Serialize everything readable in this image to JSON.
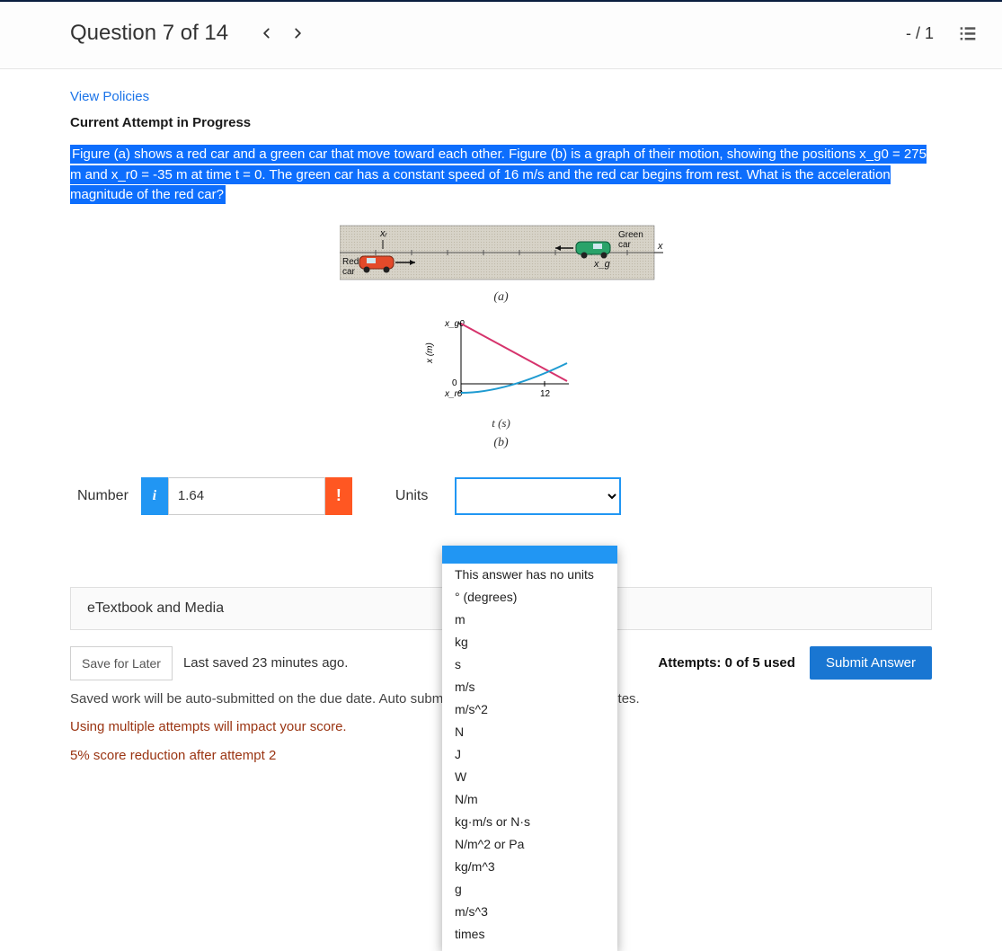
{
  "header": {
    "title": "Question 7 of 14",
    "score": "- / 1"
  },
  "policies_link": "View Policies",
  "attempt_status": "Current Attempt in Progress",
  "question": {
    "text": "Figure (a) shows a red car and a green car that move toward each other. Figure (b) is a graph of their motion, showing the positions x_g0 = 275 m and x_r0 = -35 m at time t = 0. The green car has a constant speed of 16 m/s and the red car begins from rest. What is the acceleration magnitude of the red car?",
    "fig_a_caption": "(a)",
    "fig_b_caption": "(b)",
    "diagram": {
      "red_car_label": "Red car",
      "green_car_label": "Green car",
      "xr_label": "xᵣ",
      "xg_label": "x_g",
      "axis": "x"
    },
    "graph": {
      "y_axis": "x (m)",
      "x_axis": "t (s)",
      "y_top": "x_g0",
      "y_mid": "0",
      "y_bot": "x_r0",
      "x_tick": "12"
    }
  },
  "answer": {
    "number_label": "Number",
    "number_value": "1.64",
    "units_label": "Units",
    "units_options": [
      "This answer has no units",
      "° (degrees)",
      "m",
      "kg",
      "s",
      "m/s",
      "m/s^2",
      "N",
      "J",
      "W",
      "N/m",
      "kg·m/s or N·s",
      "N/m^2 or Pa",
      "kg/m^3",
      "g",
      "m/s^3",
      "times"
    ]
  },
  "etextbook_label": "eTextbook and Media",
  "footer": {
    "save_label": "Save for Later",
    "last_saved": "Last saved 23 minutes ago.",
    "attempts": "Attempts: 0 of 5 used",
    "submit_label": "Submit Answer",
    "auto_note": "Saved work will be auto-submitted on the due date. Auto submission can take up to 10 minutes.",
    "penalty_a": "Using multiple attempts will impact your score.",
    "penalty_b": "5% score reduction after attempt 2"
  },
  "chart_data": {
    "type": "line",
    "title": "",
    "xlabel": "t (s)",
    "ylabel": "x (m)",
    "xlim": [
      0,
      14
    ],
    "ylim": [
      -35,
      275
    ],
    "series": [
      {
        "name": "green car",
        "x": [
          0,
          14
        ],
        "values": [
          275,
          51
        ],
        "note": "linear, constant speed 16 m/s toward origin"
      },
      {
        "name": "red car",
        "x": [
          0,
          14
        ],
        "values": [
          -35,
          80
        ],
        "note": "parabolic, starts at rest, accel > 0; crosses green ≈ t=12"
      }
    ],
    "annotations": [
      {
        "label": "x_g0",
        "x": 0,
        "y": 275
      },
      {
        "label": "0",
        "x": 0,
        "y": 0
      },
      {
        "label": "x_r0",
        "x": 0,
        "y": -35
      },
      {
        "label": "12",
        "x": 12,
        "y": 0
      }
    ]
  }
}
